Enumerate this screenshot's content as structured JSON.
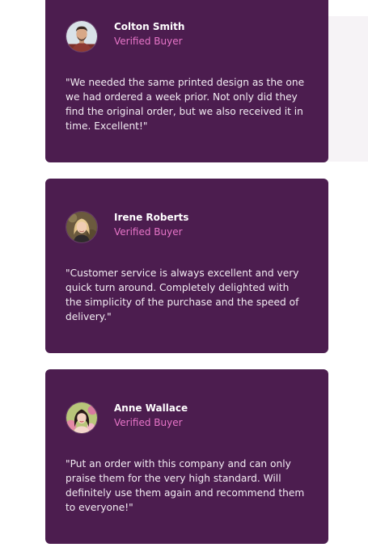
{
  "testimonials": [
    {
      "name": "Colton Smith",
      "role": "Verified Buyer",
      "quote": "\"We needed the same printed design as the one we had ordered a week prior. Not only did they find the original order, but we also received it in time. Excellent!\"",
      "avatar_icon": "male-avatar-icon"
    },
    {
      "name": "Irene Roberts",
      "role": "Verified Buyer",
      "quote": "\"Customer service is always excellent and very quick turn around. Completely delighted with the simplicity of the purchase and the speed of delivery.\"",
      "avatar_icon": "female-blonde-avatar-icon"
    },
    {
      "name": "Anne Wallace",
      "role": "Verified Buyer",
      "quote": "\"Put an order with this company and can only praise them for the very high standard. Will definitely use them again and recommend them to everyone!\"",
      "avatar_icon": "female-dark-hair-avatar-icon"
    }
  ],
  "colors": {
    "card_background": "#4c1d4f",
    "role_text": "#e775c8",
    "page_background": "#ffffff"
  }
}
